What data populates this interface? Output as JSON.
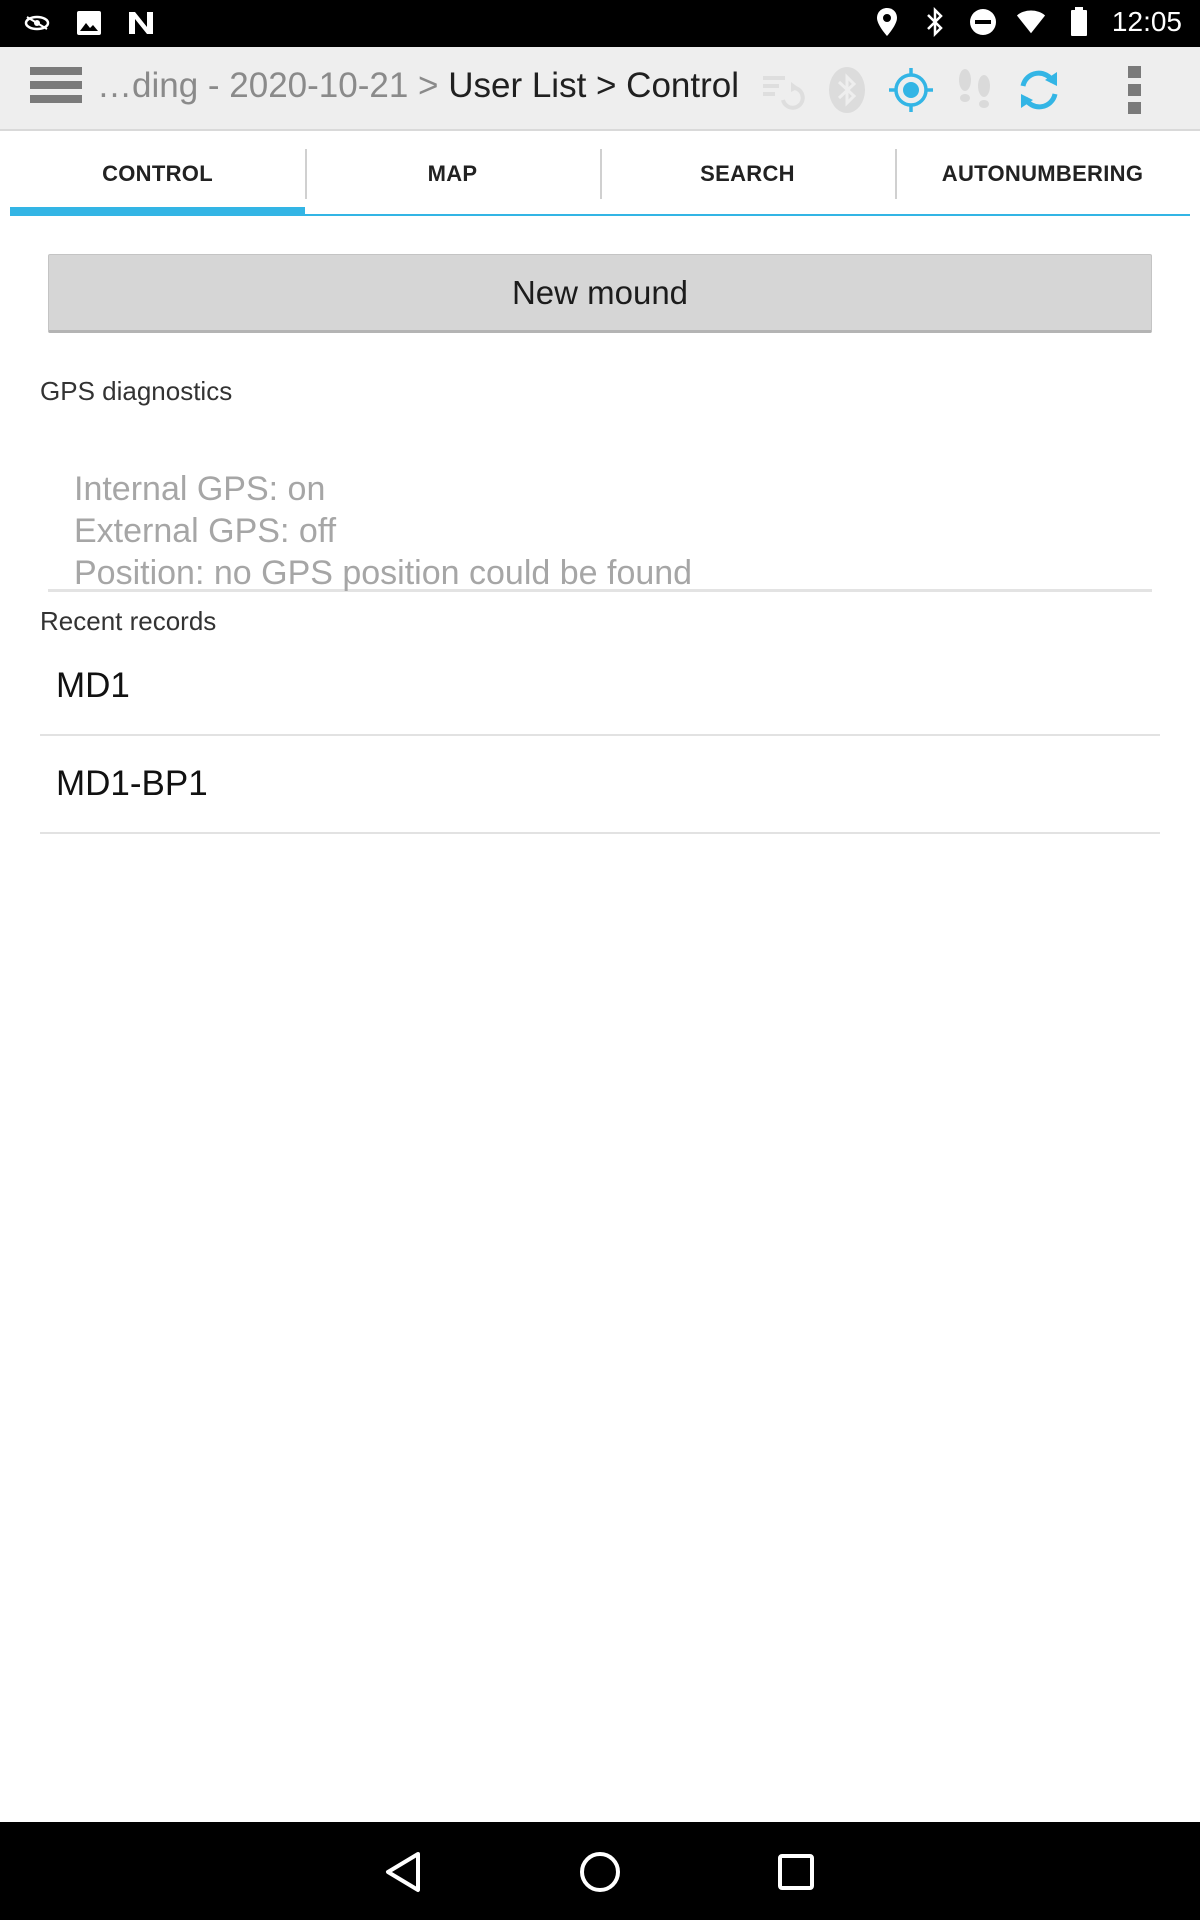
{
  "status_bar": {
    "time": "12:05",
    "left_icons": [
      "eye-notification-icon",
      "image-notification-icon",
      "n-notification-icon"
    ],
    "right_icons": [
      "location-icon",
      "bluetooth-icon",
      "do-not-disturb-icon",
      "wifi-icon",
      "battery-icon"
    ]
  },
  "action_bar": {
    "breadcrumb_dim": "…ding - 2020-10-21 > ",
    "breadcrumb_main": "User List > Control",
    "icons": [
      "sync-status-icon",
      "bluetooth-icon",
      "gps-target-icon",
      "footsteps-icon",
      "refresh-icon",
      "overflow-menu-icon"
    ],
    "accent_color": "#33b5e5"
  },
  "tabs": [
    {
      "label": "CONTROL",
      "active": true
    },
    {
      "label": "MAP",
      "active": false
    },
    {
      "label": "SEARCH",
      "active": false
    },
    {
      "label": "AUTONUMBERING",
      "active": false
    }
  ],
  "content": {
    "new_button_label": "New mound",
    "gps_label": "GPS diagnostics",
    "gps_lines": [
      "Internal GPS: on",
      "External GPS: off",
      "Position: no GPS position could be found"
    ],
    "recent_label": "Recent records",
    "records": [
      "MD1",
      "MD1-BP1"
    ]
  },
  "nav_bar": {
    "icons": [
      "back-icon",
      "home-icon",
      "recents-icon"
    ]
  }
}
